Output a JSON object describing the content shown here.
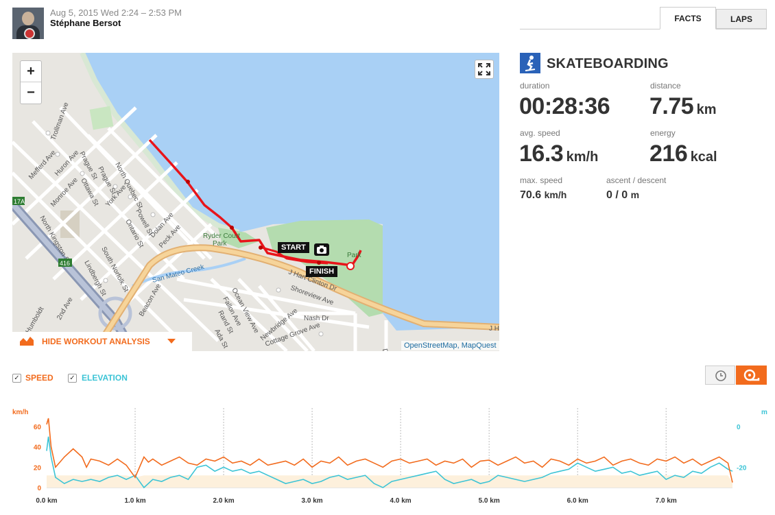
{
  "header": {
    "date": "Aug 5, 2015 Wed 2:24 – 2:53 PM",
    "user": "Stéphane Bersot",
    "tabs": [
      "FACTS",
      "LAPS"
    ]
  },
  "map": {
    "zoom_in": "+",
    "zoom_out": "−",
    "attribution": "OpenStreetMap, MapQuest",
    "start_label": "START",
    "finish_label": "FINISH",
    "hide_analysis": "HIDE WORKOUT ANALYSIS",
    "street_labels": [
      "Trollman Ave",
      "Prague St",
      "Mefferd Ave",
      "Huron Ave",
      "Ottawa St",
      "Prague St",
      "North Quebec St",
      "Monroe Ave",
      "North Kingston St",
      "York Ave",
      "Powell St",
      "Ontario St",
      "Dolan Ave",
      "Peck Ave",
      "South Norfolk St",
      "Lindbergh St",
      "San Mateo Creek",
      "J Hart Clinton Dr",
      "Shoreview Ave",
      "Ocean View Ave",
      "Fallon Ave",
      "Rand St",
      "Ada St",
      "Newbridge Ave",
      "Cottage Grove Ave",
      "Nash Dr",
      "Beacon Ave",
      "2nd Ave",
      "South Humboldt",
      "Ryder Court Park",
      "Park",
      "Detroit Dr",
      "J Hart Clinton Dr"
    ],
    "route_shields": [
      "17A",
      "416"
    ],
    "colors": {
      "water": "#a9d0f5",
      "land": "#e8e6e1",
      "park": "#b4dcaf",
      "route": "#e8141a",
      "highway": "#f0c27b"
    }
  },
  "stats": {
    "sport": "SKATEBOARDING",
    "duration_label": "duration",
    "duration": "00:28:36",
    "distance_label": "distance",
    "distance_value": "7.75",
    "distance_unit": "km",
    "avg_speed_label": "avg. speed",
    "avg_speed_value": "16.3",
    "avg_speed_unit": "km/h",
    "energy_label": "energy",
    "energy_value": "216",
    "energy_unit": "kcal",
    "max_speed_label": "max. speed",
    "max_speed_value": "70.6",
    "max_speed_unit": "km/h",
    "ascent_label": "ascent / descent",
    "ascent_value": "0 / 0",
    "ascent_unit": "m"
  },
  "controls": {
    "speed_label": "SPEED",
    "elevation_label": "ELEVATION",
    "speed_checked": true,
    "elevation_checked": true,
    "time_icon": "clock-icon",
    "distance_icon": "tape-measure-icon"
  },
  "chart_data": {
    "type": "line",
    "left_axis_unit": "km/h",
    "right_axis_unit": "m",
    "left_ticks": [
      0,
      20,
      40,
      60
    ],
    "right_ticks": [
      0,
      -20
    ],
    "x_ticks": [
      "0.0 km",
      "1.0 km",
      "2.0 km",
      "3.0 km",
      "4.0 km",
      "5.0 km",
      "6.0 km",
      "7.0 km"
    ],
    "xlim": [
      0,
      7.75
    ],
    "ylim_speed": [
      0,
      70
    ],
    "ylim_elevation": [
      -30,
      5
    ],
    "series": [
      {
        "name": "SPEED",
        "color": "#f26b1d",
        "x": [
          0,
          0.02,
          0.05,
          0.1,
          0.15,
          0.2,
          0.3,
          0.4,
          0.45,
          0.5,
          0.6,
          0.7,
          0.8,
          0.9,
          1.0,
          1.1,
          1.15,
          1.2,
          1.3,
          1.4,
          1.5,
          1.6,
          1.7,
          1.8,
          1.9,
          2.0,
          2.1,
          2.2,
          2.3,
          2.4,
          2.5,
          2.6,
          2.7,
          2.8,
          2.9,
          3.0,
          3.1,
          3.2,
          3.3,
          3.4,
          3.5,
          3.6,
          3.7,
          3.8,
          3.9,
          4.0,
          4.1,
          4.2,
          4.3,
          4.4,
          4.5,
          4.6,
          4.7,
          4.8,
          4.9,
          5.0,
          5.1,
          5.2,
          5.3,
          5.4,
          5.5,
          5.6,
          5.7,
          5.8,
          5.9,
          6.0,
          6.1,
          6.2,
          6.3,
          6.4,
          6.5,
          6.6,
          6.7,
          6.8,
          6.9,
          7.0,
          7.1,
          7.2,
          7.3,
          7.4,
          7.5,
          7.6,
          7.7,
          7.75
        ],
        "values": [
          62,
          68,
          40,
          20,
          25,
          30,
          38,
          30,
          20,
          28,
          26,
          22,
          28,
          22,
          10,
          30,
          25,
          28,
          22,
          26,
          30,
          24,
          22,
          28,
          26,
          30,
          24,
          26,
          22,
          28,
          22,
          24,
          26,
          22,
          28,
          20,
          26,
          24,
          30,
          22,
          26,
          28,
          24,
          20,
          26,
          28,
          24,
          26,
          28,
          22,
          26,
          24,
          28,
          20,
          26,
          27,
          22,
          26,
          30,
          24,
          26,
          20,
          28,
          26,
          22,
          28,
          24,
          26,
          30,
          22,
          26,
          28,
          24,
          22,
          28,
          26,
          30,
          24,
          28,
          22,
          26,
          30,
          24,
          5
        ]
      },
      {
        "name": "ELEVATION",
        "color": "#3cc4d6",
        "x": [
          0,
          0.02,
          0.05,
          0.1,
          0.2,
          0.3,
          0.4,
          0.5,
          0.6,
          0.7,
          0.8,
          0.9,
          1.0,
          1.1,
          1.2,
          1.3,
          1.4,
          1.5,
          1.6,
          1.7,
          1.8,
          1.9,
          2.0,
          2.1,
          2.2,
          2.3,
          2.4,
          2.5,
          2.6,
          2.7,
          2.8,
          2.9,
          3.0,
          3.1,
          3.2,
          3.3,
          3.4,
          3.5,
          3.6,
          3.7,
          3.8,
          3.9,
          4.0,
          4.1,
          4.2,
          4.3,
          4.4,
          4.5,
          4.6,
          4.7,
          4.8,
          4.9,
          5.0,
          5.1,
          5.2,
          5.3,
          5.4,
          5.5,
          5.6,
          5.7,
          5.8,
          5.9,
          6.0,
          6.1,
          6.2,
          6.3,
          6.4,
          6.5,
          6.6,
          6.7,
          6.8,
          6.9,
          7.0,
          7.1,
          7.2,
          7.3,
          7.4,
          7.5,
          7.6,
          7.7,
          7.75
        ],
        "values": [
          -12,
          -5,
          -15,
          -25,
          -28,
          -26,
          -27,
          -26,
          -27,
          -25,
          -24,
          -26,
          -24,
          -30,
          -26,
          -27,
          -25,
          -24,
          -26,
          -20,
          -19,
          -22,
          -20,
          -22,
          -21,
          -23,
          -22,
          -24,
          -26,
          -28,
          -27,
          -26,
          -28,
          -27,
          -25,
          -24,
          -26,
          -25,
          -24,
          -28,
          -30,
          -27,
          -26,
          -25,
          -24,
          -23,
          -22,
          -26,
          -28,
          -27,
          -26,
          -28,
          -27,
          -24,
          -25,
          -26,
          -27,
          -26,
          -25,
          -23,
          -22,
          -21,
          -18,
          -20,
          -22,
          -21,
          -20,
          -23,
          -22,
          -24,
          -23,
          -22,
          -26,
          -24,
          -25,
          -22,
          -23,
          -20,
          -18,
          -21,
          -22
        ]
      }
    ]
  }
}
